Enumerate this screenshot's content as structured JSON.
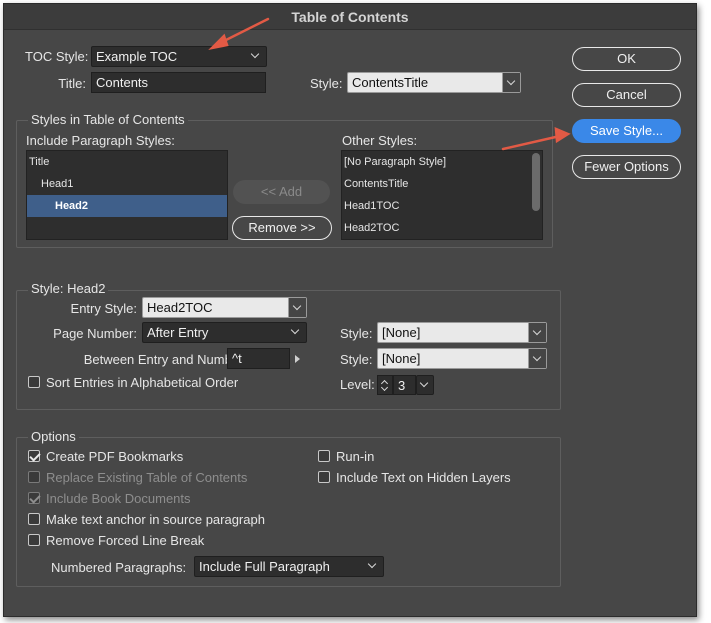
{
  "window": {
    "title": "Table of Contents"
  },
  "toc": {
    "style_label": "TOC Style:",
    "style_value": "Example TOC",
    "title_label": "Title:",
    "title_value": "Contents",
    "title_style_label": "Style:",
    "title_style_value": "ContentsTitle"
  },
  "styles_group": {
    "title": "Styles in Table of Contents",
    "include_label": "Include Paragraph Styles:",
    "include_items": [
      {
        "label": "Title",
        "selected": false
      },
      {
        "label": "Head1",
        "selected": false
      },
      {
        "label": "Head2",
        "selected": true
      }
    ],
    "add_label": "<< Add",
    "remove_label": "Remove >>",
    "other_label": "Other Styles:",
    "other_items": [
      "[No Paragraph Style]",
      "ContentsTitle",
      "Head1TOC",
      "Head2TOC"
    ]
  },
  "style_group": {
    "title": "Style: Head2",
    "entry_style_label": "Entry Style:",
    "entry_style_value": "Head2TOC",
    "page_number_label": "Page Number:",
    "page_number_value": "After Entry",
    "page_number_style_label": "Style:",
    "page_number_style_value": "[None]",
    "between_label": "Between Entry and Number:",
    "between_value": "^t",
    "between_style_label": "Style:",
    "between_style_value": "[None]",
    "sort_label": "Sort Entries in Alphabetical Order",
    "sort_checked": false,
    "level_label": "Level:",
    "level_value": "3"
  },
  "options_group": {
    "title": "Options",
    "create_pdf": {
      "label": "Create PDF Bookmarks",
      "checked": true
    },
    "replace_existing": {
      "label": "Replace Existing Table of Contents",
      "checked": false,
      "disabled": true
    },
    "include_book": {
      "label": "Include Book Documents",
      "checked": true,
      "disabled": true
    },
    "make_anchor": {
      "label": "Make text anchor in source paragraph",
      "checked": false
    },
    "remove_forced": {
      "label": "Remove Forced Line Break",
      "checked": false
    },
    "run_in": {
      "label": "Run-in",
      "checked": false
    },
    "include_hidden": {
      "label": "Include Text on Hidden Layers",
      "checked": false
    },
    "numbered_label": "Numbered Paragraphs:",
    "numbered_value": "Include Full Paragraph"
  },
  "buttons": {
    "ok": "OK",
    "cancel": "Cancel",
    "save_style": "Save Style...",
    "fewer_options": "Fewer Options"
  },
  "colors": {
    "dialog_bg": "#474747",
    "primary_button": "#3a88e8",
    "selection": "#3f5f8a",
    "annotation_arrow": "#e25a45"
  }
}
